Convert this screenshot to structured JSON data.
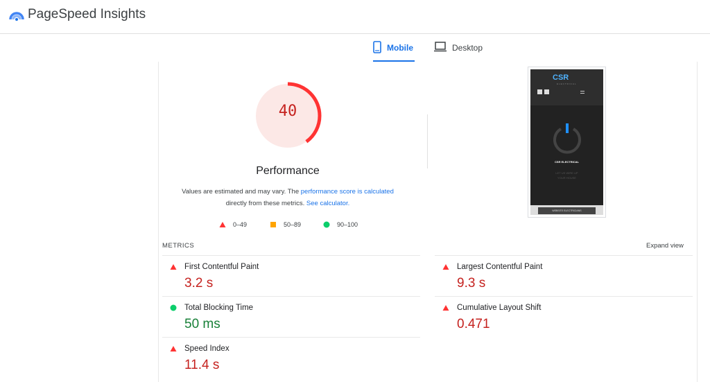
{
  "app": {
    "title": "PageSpeed Insights"
  },
  "tabs": [
    {
      "label": "Mobile",
      "icon": "smartphone-icon",
      "active": true
    },
    {
      "label": "Desktop",
      "icon": "laptop-icon",
      "active": false
    }
  ],
  "performance": {
    "score": "40",
    "score_value": 40,
    "title": "Performance",
    "desc_prefix": "Values are estimated and may vary. The ",
    "desc_link1": "performance score is calculated",
    "desc_middle": "directly from these metrics. ",
    "desc_link2": "See calculator."
  },
  "legend": {
    "fail": "0–49",
    "average": "50–89",
    "pass": "90–100"
  },
  "thumbnail": {
    "logo": "CSR",
    "sub": "ELECTRICAL",
    "headline": "CSR ELECTRICAL",
    "tagline_line1": "LET US WIRE UP",
    "tagline_line2": "YOUR HOUSE",
    "button": "WEBSITE ELECTRICIANS"
  },
  "metrics": {
    "section_label": "METRICS",
    "expand_label": "Expand view",
    "items": [
      {
        "label": "First Contentful Paint",
        "value": "3.2 s",
        "status": "fail"
      },
      {
        "label": "Largest Contentful Paint",
        "value": "9.3 s",
        "status": "fail"
      },
      {
        "label": "Total Blocking Time",
        "value": "50 ms",
        "status": "pass"
      },
      {
        "label": "Cumulative Layout Shift",
        "value": "0.471",
        "status": "fail"
      },
      {
        "label": "Speed Index",
        "value": "11.4 s",
        "status": "fail"
      }
    ]
  },
  "colors": {
    "fail": "#c5221f",
    "average": "#ffa400",
    "pass": "#0cce6b",
    "accent": "#1a73e8"
  }
}
